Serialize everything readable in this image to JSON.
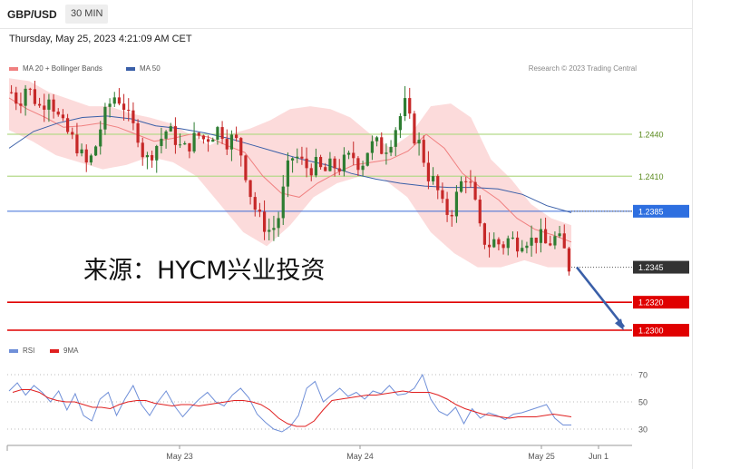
{
  "header": {
    "symbol": "GBP/USD",
    "timeframe": "30 MIN"
  },
  "timestamp": "Thursday, May 25, 2023 4:21:09 AM CET",
  "legend": [
    {
      "label": "MA 20 + Bollinger Bands",
      "color": "#f08080"
    },
    {
      "label": "MA 50",
      "color": "#3a5fa8"
    }
  ],
  "credit": "Research © 2023 Trading Central",
  "watermark": "来源：HYCM兴业投资",
  "rsi_legend": [
    {
      "label": "RSI",
      "color": "#6f8fd8"
    },
    {
      "label": "9MA",
      "color": "#e02020"
    }
  ],
  "colors": {
    "up": "#2e7d32",
    "down": "#c62828",
    "band": "#fbd5d5",
    "ma50": "#3a5fa8",
    "ma20": "#f08080",
    "resistance": "#b5d98a",
    "support": "#e00000",
    "pivot": "#3a6bd6",
    "arrow": "#3a5fa8"
  },
  "chart_data": [
    {
      "type": "candlestick",
      "title": "GBP/USD",
      "timeframe": "30 MIN",
      "ylim": [
        1.2285,
        1.247
      ],
      "x_ticks": [
        "May 23",
        "May 24",
        "May 25",
        "Jun 1"
      ],
      "levels": [
        {
          "value": 1.244,
          "label": "1.2440",
          "kind": "resistance"
        },
        {
          "value": 1.241,
          "label": "1.2410",
          "kind": "resistance"
        },
        {
          "value": 1.2385,
          "label": "1.2385",
          "kind": "pivot"
        },
        {
          "value": 1.2345,
          "label": "1.2345",
          "kind": "last"
        },
        {
          "value": 1.232,
          "label": "1.2320",
          "kind": "support"
        },
        {
          "value": 1.23,
          "label": "1.2300",
          "kind": "support"
        }
      ],
      "forecast_arrow": {
        "from": 1.2345,
        "to": 1.2305,
        "direction": "down"
      },
      "series": [
        {
          "name": "MA 20 + Bollinger Bands",
          "kind": "ma_bands"
        },
        {
          "name": "MA 50",
          "kind": "ma"
        }
      ],
      "close_path": [
        1.247,
        1.2462,
        1.2475,
        1.2466,
        1.2458,
        1.247,
        1.2455,
        1.2445,
        1.2438,
        1.243,
        1.2418,
        1.2425,
        1.2445,
        1.246,
        1.2468,
        1.2462,
        1.2448,
        1.244,
        1.242,
        1.2428,
        1.2436,
        1.2444,
        1.2437,
        1.2428,
        1.2433,
        1.244,
        1.2436,
        1.244,
        1.2445,
        1.2435,
        1.2438,
        1.2425,
        1.24,
        1.2383,
        1.2375,
        1.237,
        1.2382,
        1.2413,
        1.2426,
        1.242,
        1.2415,
        1.2418,
        1.2412,
        1.2418,
        1.2416,
        1.2422,
        1.2424,
        1.2417,
        1.243,
        1.2434,
        1.2428,
        1.2436,
        1.2449,
        1.2462,
        1.244,
        1.2432,
        1.2411,
        1.2405,
        1.2388,
        1.2382,
        1.2398,
        1.2412,
        1.24,
        1.2372,
        1.236,
        1.2364,
        1.236,
        1.2366,
        1.2362,
        1.2366,
        1.2364,
        1.2368,
        1.236,
        1.2366,
        1.2363,
        1.2345
      ],
      "ma50_path": [
        1.243,
        1.2442,
        1.2448,
        1.2452,
        1.2453,
        1.2451,
        1.2446,
        1.2444,
        1.2441,
        1.2437,
        1.2432,
        1.2427,
        1.2422,
        1.2418,
        1.2412,
        1.2408,
        1.2405,
        1.2403,
        1.2402,
        1.2402,
        1.2401,
        1.2397,
        1.2389,
        1.2384
      ],
      "ma20_path": [
        1.2466,
        1.2458,
        1.2452,
        1.2445,
        1.2446,
        1.2448,
        1.2445,
        1.244,
        1.2435,
        1.2437,
        1.244,
        1.2438,
        1.2432,
        1.2427,
        1.241,
        1.2398,
        1.2395,
        1.2405,
        1.2412,
        1.2418,
        1.242,
        1.2422,
        1.2428,
        1.244,
        1.243,
        1.2412,
        1.2402,
        1.2393,
        1.238,
        1.2372,
        1.2368,
        1.2363
      ],
      "band_upper_path": [
        1.248,
        1.2478,
        1.247,
        1.2465,
        1.246,
        1.246,
        1.2455,
        1.2452,
        1.2448,
        1.244,
        1.2432,
        1.244,
        1.2444,
        1.245,
        1.2458,
        1.246,
        1.2458,
        1.2452,
        1.244,
        1.243,
        1.244,
        1.246,
        1.2462,
        1.2452,
        1.2422,
        1.2408,
        1.239,
        1.238,
        1.2375
      ],
      "band_lower_path": [
        1.2443,
        1.2435,
        1.2425,
        1.242,
        1.2415,
        1.2418,
        1.2424,
        1.242,
        1.241,
        1.239,
        1.237,
        1.236,
        1.2375,
        1.2395,
        1.2405,
        1.241,
        1.2408,
        1.2395,
        1.237,
        1.2355,
        1.2345,
        1.2345,
        1.235,
        1.2345,
        1.2345
      ]
    },
    {
      "type": "line",
      "title": "RSI",
      "ylim": [
        22,
        75
      ],
      "y_ticks": [
        70,
        50,
        30
      ],
      "series": [
        {
          "name": "RSI",
          "values": [
            58,
            64,
            55,
            62,
            57,
            50,
            58,
            44,
            56,
            40,
            36,
            52,
            57,
            40,
            52,
            62,
            48,
            40,
            50,
            58,
            47,
            39,
            46,
            52,
            57,
            50,
            47,
            55,
            60,
            53,
            41,
            35,
            30,
            28,
            32,
            40,
            60,
            65,
            50,
            55,
            60,
            54,
            57,
            52,
            58,
            56,
            62,
            55,
            56,
            60,
            70,
            52,
            43,
            40,
            46,
            34,
            45,
            38,
            42,
            40,
            37,
            41,
            42,
            44,
            46,
            48,
            38,
            33,
            33
          ]
        },
        {
          "name": "9MA",
          "values": [
            57,
            59,
            59,
            57,
            53,
            51,
            50,
            50,
            48,
            46,
            46,
            45,
            48,
            50,
            51,
            51,
            49,
            48,
            47,
            48,
            48,
            47,
            48,
            49,
            50,
            51,
            51,
            50,
            48,
            44,
            38,
            34,
            32,
            32,
            36,
            44,
            51,
            52,
            53,
            54,
            55,
            55,
            56,
            57,
            58,
            57,
            57,
            57,
            55,
            52,
            48,
            45,
            43,
            41,
            40,
            39,
            38,
            39,
            39,
            39,
            40,
            41,
            40,
            39
          ]
        }
      ]
    }
  ]
}
